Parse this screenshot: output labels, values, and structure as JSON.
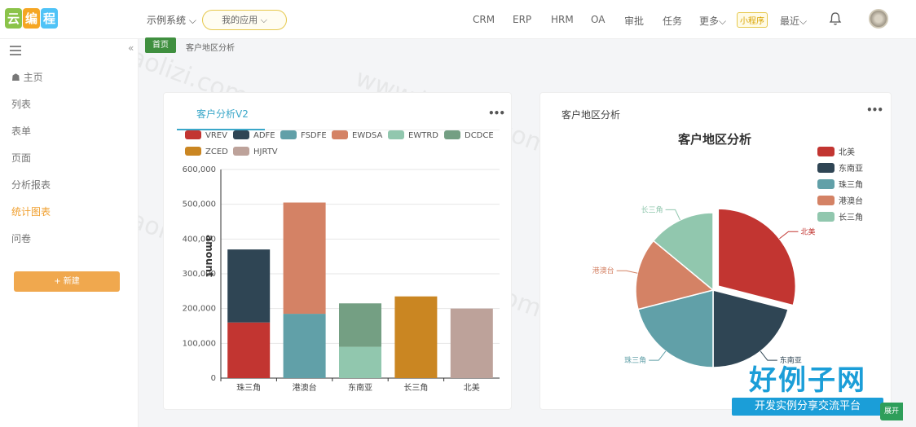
{
  "header": {
    "logo_chars": [
      "云",
      "编",
      "程"
    ],
    "system_select": "示例系统",
    "my_apps": "我的应用",
    "nav": [
      "CRM",
      "ERP",
      "HRM",
      "OA",
      "审批",
      "任务",
      "更多"
    ],
    "mini_program": "小程序",
    "recent": "最近"
  },
  "sidebar": {
    "items": [
      {
        "label": "主页"
      },
      {
        "label": "列表"
      },
      {
        "label": "表单"
      },
      {
        "label": "页面"
      },
      {
        "label": "分析报表"
      },
      {
        "label": "统计图表"
      },
      {
        "label": "问卷"
      }
    ],
    "active_index": 5,
    "new_button": "+ 新建"
  },
  "breadcrumb": {
    "home": "首页",
    "page": "客户地区分析"
  },
  "card1": {
    "tab": "客户分析V2"
  },
  "card2": {
    "title": "客户地区分析"
  },
  "colors": {
    "VREV": "#c23531",
    "ADFE": "#2f4554",
    "FSDFE": "#61a0a8",
    "EWDSA": "#d48265",
    "EWTRD": "#91c7ae",
    "DCDCE": "#749f83",
    "ZCED": "#ca8622",
    "HJRTV": "#bda29a",
    "accent": "#f0a030",
    "tab": "#3aa7c9"
  },
  "chart_data": [
    {
      "type": "bar",
      "stacked": true,
      "title": "",
      "ylabel": "amount",
      "xlabel": "",
      "ylim": [
        0,
        600000
      ],
      "yticks": [
        "0",
        "100,000",
        "200,000",
        "300,000",
        "400,000",
        "500,000",
        "600,000"
      ],
      "categories": [
        "珠三角",
        "港澳台",
        "东南亚",
        "长三角",
        "北美"
      ],
      "legend": [
        "VREV",
        "ADFE",
        "FSDFE",
        "EWDSA",
        "EWTRD",
        "DCDCE",
        "ZCED",
        "HJRTV"
      ],
      "series": [
        {
          "name": "VREV",
          "values": [
            160000,
            0,
            0,
            0,
            0
          ]
        },
        {
          "name": "ADFE",
          "values": [
            210000,
            0,
            0,
            0,
            0
          ]
        },
        {
          "name": "FSDFE",
          "values": [
            0,
            185000,
            0,
            0,
            0
          ]
        },
        {
          "name": "EWDSA",
          "values": [
            0,
            320000,
            0,
            0,
            0
          ]
        },
        {
          "name": "EWTRD",
          "values": [
            0,
            0,
            90000,
            0,
            0
          ]
        },
        {
          "name": "DCDCE",
          "values": [
            0,
            0,
            125000,
            0,
            0
          ]
        },
        {
          "name": "ZCED",
          "values": [
            0,
            0,
            0,
            235000,
            0
          ]
        },
        {
          "name": "HJRTV",
          "values": [
            0,
            0,
            0,
            0,
            200000
          ]
        }
      ]
    },
    {
      "type": "pie",
      "title": "客户地区分析",
      "legend": [
        "北美",
        "东南亚",
        "珠三角",
        "港澳台",
        "长三角"
      ],
      "slices": [
        {
          "label": "北美",
          "value": 29,
          "color": "#c23531",
          "exploded": true
        },
        {
          "label": "东南亚",
          "value": 21,
          "color": "#2f4554"
        },
        {
          "label": "珠三角",
          "value": 21,
          "color": "#61a0a8"
        },
        {
          "label": "港澳台",
          "value": 15,
          "color": "#d48265"
        },
        {
          "label": "长三角",
          "value": 14,
          "color": "#91c7ae"
        }
      ]
    }
  ],
  "brand": {
    "main": "好例子网",
    "sub": "开发实例分享交流平台"
  },
  "float_button": "展开",
  "watermark": "www.haolizi.com"
}
